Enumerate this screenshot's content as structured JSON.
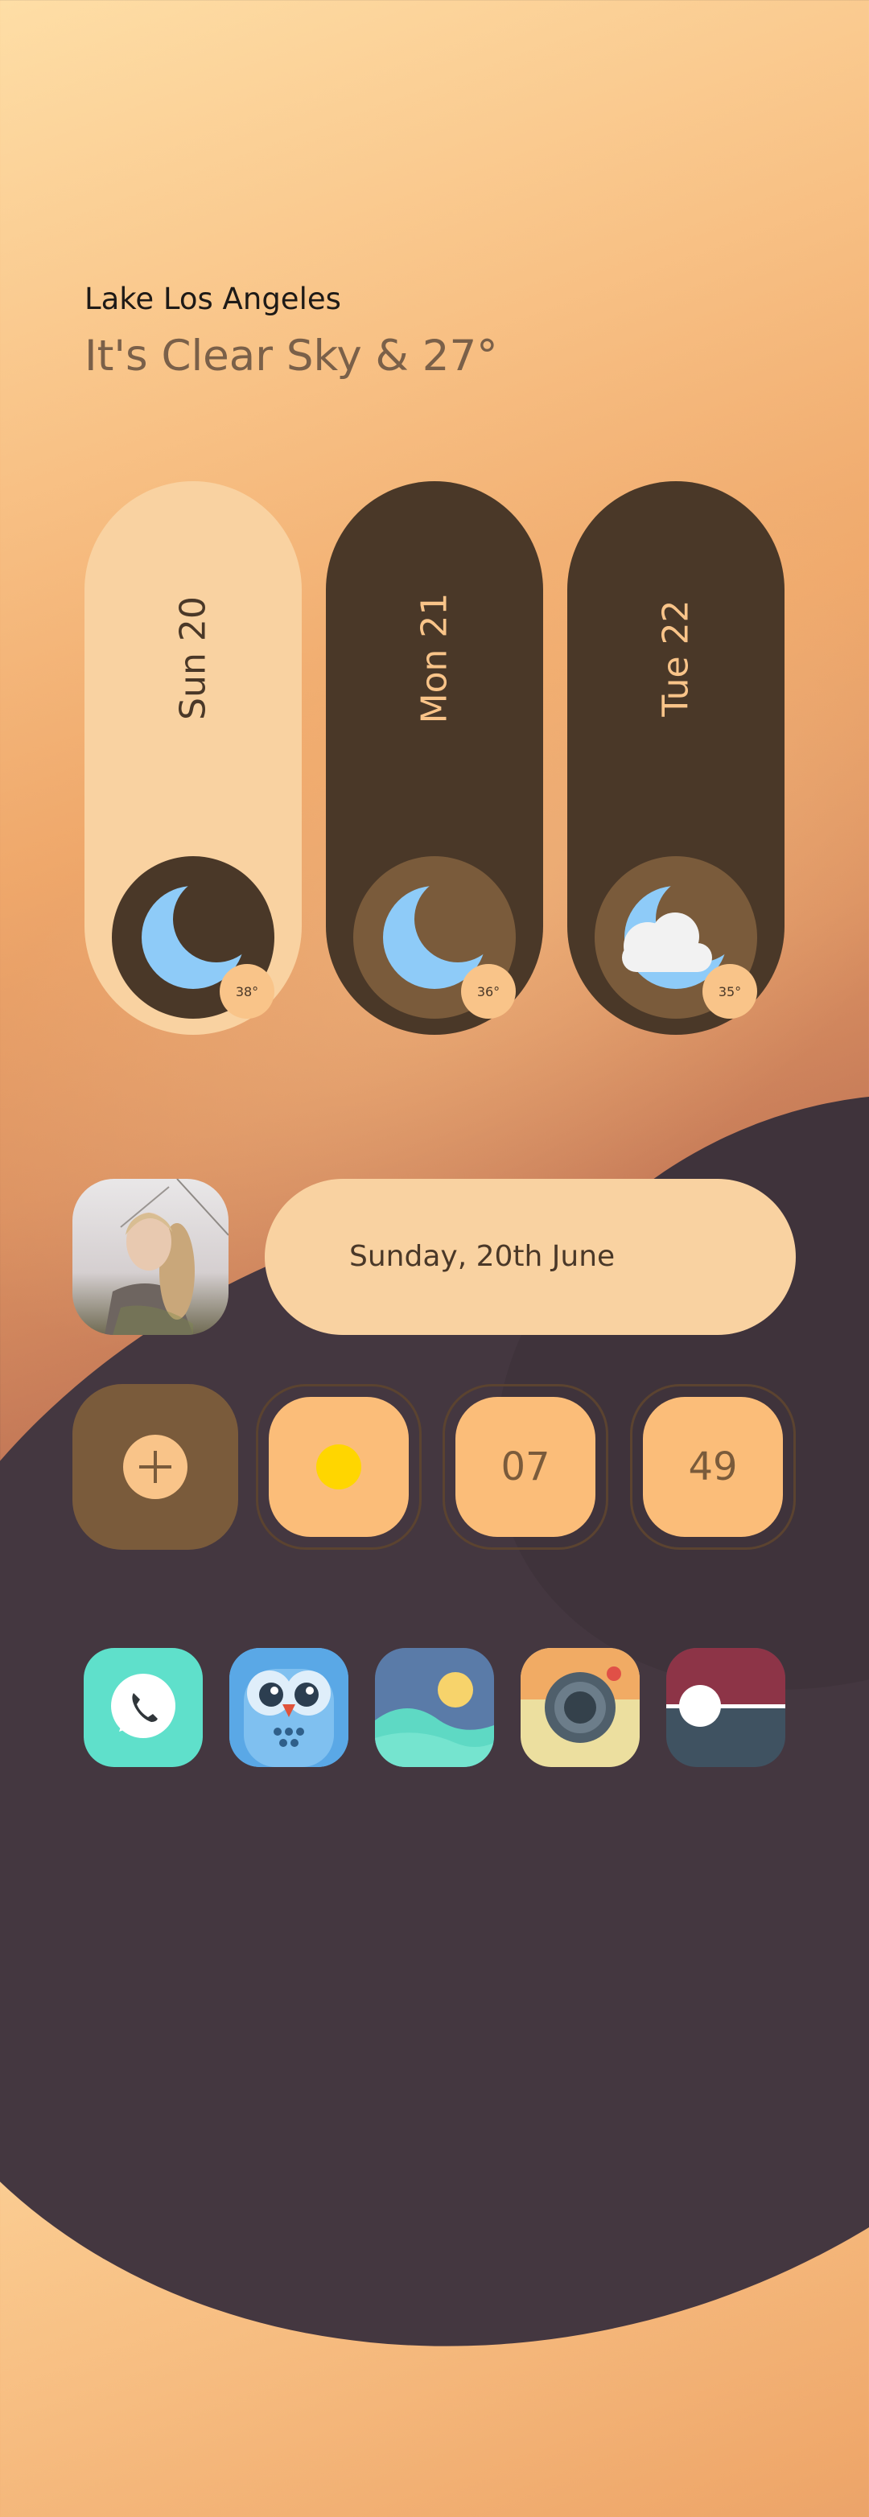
{
  "weather": {
    "location": "Lake Los Angeles",
    "headline": "It's Clear Sky & 27°"
  },
  "forecast": [
    {
      "day": "Sun 20",
      "temp": "38°",
      "icon": "moon-icon"
    },
    {
      "day": "Mon 21",
      "temp": "36°",
      "icon": "moon-icon"
    },
    {
      "day": "Tue 22",
      "temp": "35°",
      "icon": "moon-cloud-icon"
    }
  ],
  "date_widget": {
    "text": "Sunday, 20th June"
  },
  "clock": {
    "hour": "07",
    "minute": "49"
  },
  "dock": [
    {
      "name": "phone-app-icon"
    },
    {
      "name": "owl-app-icon"
    },
    {
      "name": "gallery-app-icon"
    },
    {
      "name": "camera-app-icon"
    },
    {
      "name": "toggle-app-icon"
    }
  ],
  "colors": {
    "card_light": "#f9d2a1",
    "card_dark": "#4a3828",
    "accent": "#f9c489",
    "moon": "#8ecbf8",
    "sun": "#ffd600"
  }
}
